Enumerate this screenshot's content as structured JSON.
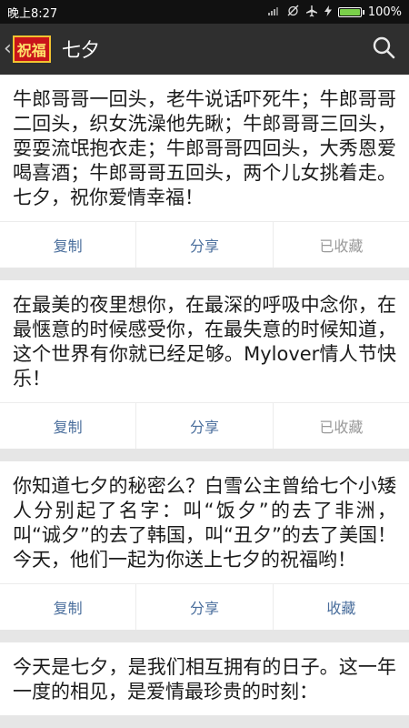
{
  "status_bar": {
    "time": "晚上8:27",
    "battery": "100%"
  },
  "app_bar": {
    "logo_text": "祝福",
    "title": "七夕"
  },
  "cards": [
    {
      "text": "牛郎哥哥一回头，老牛说话吓死牛；牛郎哥哥二回头，织女洗澡他先瞅；牛郎哥哥三回头，耍耍流氓抱衣走；牛郎哥哥四回头，大秀恩爱喝喜酒；牛郎哥哥五回头，两个儿女挑着走。七夕，祝你爱情幸福！",
      "copy": "复制",
      "share": "分享",
      "fav": "已收藏",
      "fav_done": true
    },
    {
      "text": "在最美的夜里想你，在最深的呼吸中念你，在最惬意的时候感受你，在最失意的时候知道，这个世界有你就已经足够。Mylover情人节快乐！",
      "copy": "复制",
      "share": "分享",
      "fav": "已收藏",
      "fav_done": true
    },
    {
      "text": "你知道七夕的秘密么？白雪公主曾给七个小矮人分别起了名字：叫“饭夕”的去了非洲，叫“诚夕”的去了韩国，叫“丑夕”的去了美国！今天，他们一起为你送上七夕的祝福哟！",
      "copy": "复制",
      "share": "分享",
      "fav": "收藏",
      "fav_done": false
    },
    {
      "text": "今天是七夕，是我们相互拥有的日子。这一年一度的相见，是爱情最珍贵的时刻：",
      "copy": "",
      "share": "",
      "fav": "",
      "fav_done": false
    }
  ]
}
